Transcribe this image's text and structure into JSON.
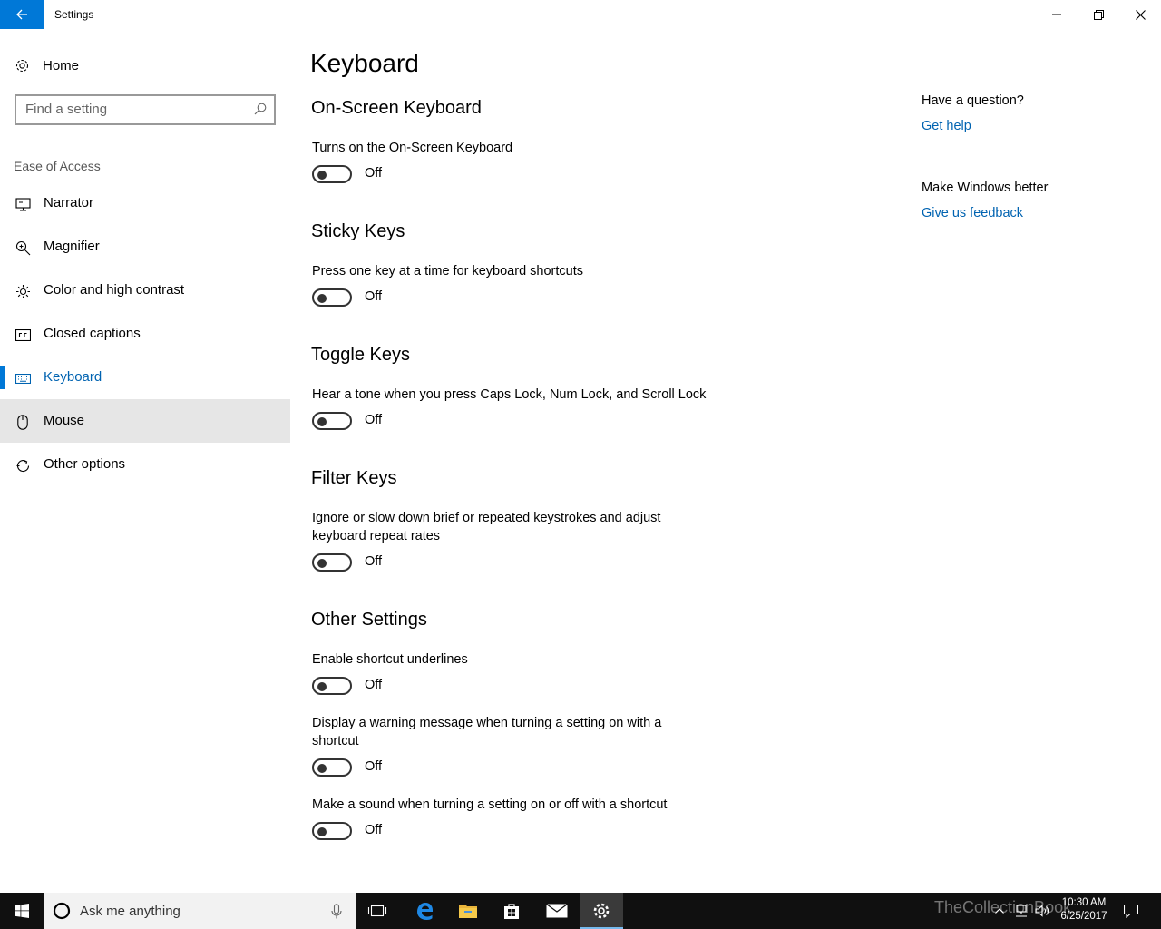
{
  "window": {
    "title": "Settings"
  },
  "sidebar": {
    "home_label": "Home",
    "search_placeholder": "Find a setting",
    "section_label": "Ease of Access",
    "items": [
      {
        "label": "Narrator",
        "icon": "narrator-icon"
      },
      {
        "label": "Magnifier",
        "icon": "magnifier-icon"
      },
      {
        "label": "Color and high contrast",
        "icon": "brightness-icon"
      },
      {
        "label": "Closed captions",
        "icon": "closed-captions-icon"
      },
      {
        "label": "Keyboard",
        "icon": "keyboard-icon",
        "selected": true
      },
      {
        "label": "Mouse",
        "icon": "mouse-icon",
        "hovered": true
      },
      {
        "label": "Other options",
        "icon": "other-options-icon"
      }
    ]
  },
  "main": {
    "title": "Keyboard",
    "sections": [
      {
        "title": "On-Screen Keyboard",
        "settings": [
          {
            "desc": "Turns on the On-Screen Keyboard",
            "state": "Off"
          }
        ]
      },
      {
        "title": "Sticky Keys",
        "settings": [
          {
            "desc": "Press one key at a time for keyboard shortcuts",
            "state": "Off"
          }
        ]
      },
      {
        "title": "Toggle Keys",
        "settings": [
          {
            "desc": "Hear a tone when you press Caps Lock, Num Lock, and Scroll Lock",
            "state": "Off"
          }
        ]
      },
      {
        "title": "Filter Keys",
        "settings": [
          {
            "desc": "Ignore or slow down brief or repeated keystrokes and adjust keyboard repeat rates",
            "state": "Off"
          }
        ]
      },
      {
        "title": "Other Settings",
        "settings": [
          {
            "desc": "Enable shortcut underlines",
            "state": "Off"
          },
          {
            "desc": "Display a warning message when turning a setting on with a shortcut",
            "state": "Off"
          },
          {
            "desc": "Make a sound when turning a setting on or off with a shortcut",
            "state": "Off"
          }
        ]
      }
    ]
  },
  "right_panel": {
    "question_heading": "Have a question?",
    "help_link": "Get help",
    "feedback_heading": "Make Windows better",
    "feedback_link": "Give us feedback"
  },
  "taskbar": {
    "search_placeholder": "Ask me anything",
    "time": "10:30 AM",
    "date": "6/25/2017",
    "watermark": "TheCollectionBook"
  },
  "colors": {
    "accent": "#0078d7",
    "link": "#0063b1",
    "hover": "#e6e6e6",
    "taskbar": "#101010"
  }
}
